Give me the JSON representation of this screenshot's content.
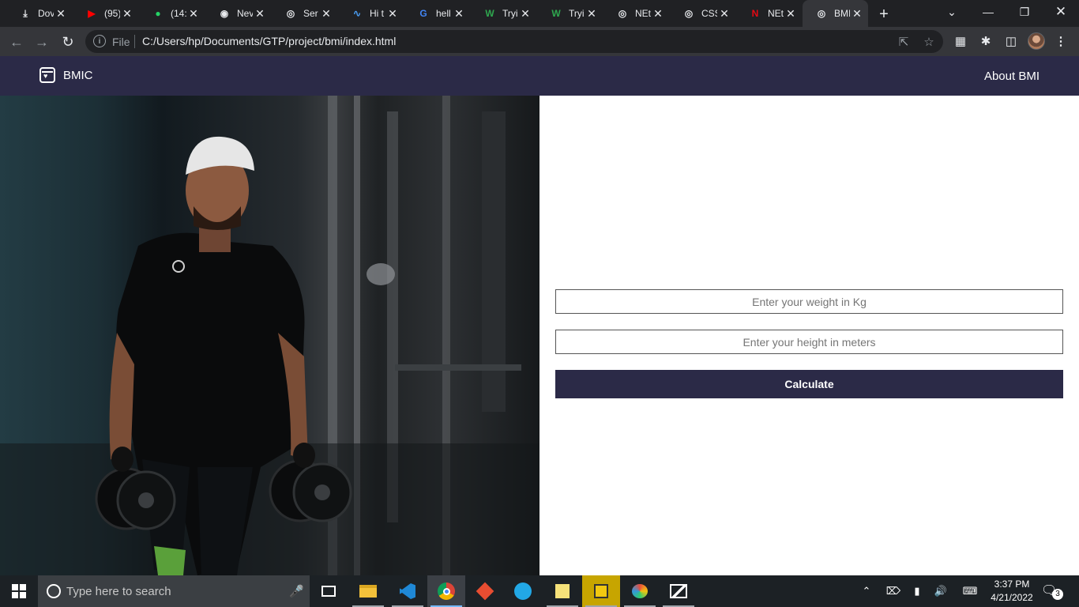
{
  "browser": {
    "tabs": [
      {
        "title": "Dov",
        "icon": "download-icon"
      },
      {
        "title": "(95)",
        "icon": "youtube-icon"
      },
      {
        "title": "(14:",
        "icon": "whatsapp-icon"
      },
      {
        "title": "Nev",
        "icon": "chrome-icon"
      },
      {
        "title": "Ser",
        "icon": "globe-icon"
      },
      {
        "title": "Hi t",
        "icon": "site-icon"
      },
      {
        "title": "hell",
        "icon": "google-icon"
      },
      {
        "title": "Tryi",
        "icon": "w-icon"
      },
      {
        "title": "Tryi",
        "icon": "w-icon"
      },
      {
        "title": "NEt",
        "icon": "globe-icon"
      },
      {
        "title": "CSS",
        "icon": "globe-icon"
      },
      {
        "title": "NEt",
        "icon": "netflix-icon"
      },
      {
        "title": "BMI",
        "icon": "globe-icon"
      }
    ],
    "address": {
      "scheme_label": "File",
      "url": "C:/Users/hp/Documents/GTP/project/bmi/index.html"
    }
  },
  "navbar": {
    "brand": "BMIC",
    "about_link": "About BMI"
  },
  "form": {
    "weight_placeholder": "Enter your weight in Kg",
    "height_placeholder": "Enter your height in meters",
    "calculate_label": "Calculate"
  },
  "taskbar": {
    "search_placeholder": "Type here to search",
    "time": "3:37 PM",
    "date": "4/21/2022",
    "notification_count": "3"
  },
  "colors": {
    "navbar_bg": "#2b2a47",
    "button_bg": "#2b2a47"
  }
}
